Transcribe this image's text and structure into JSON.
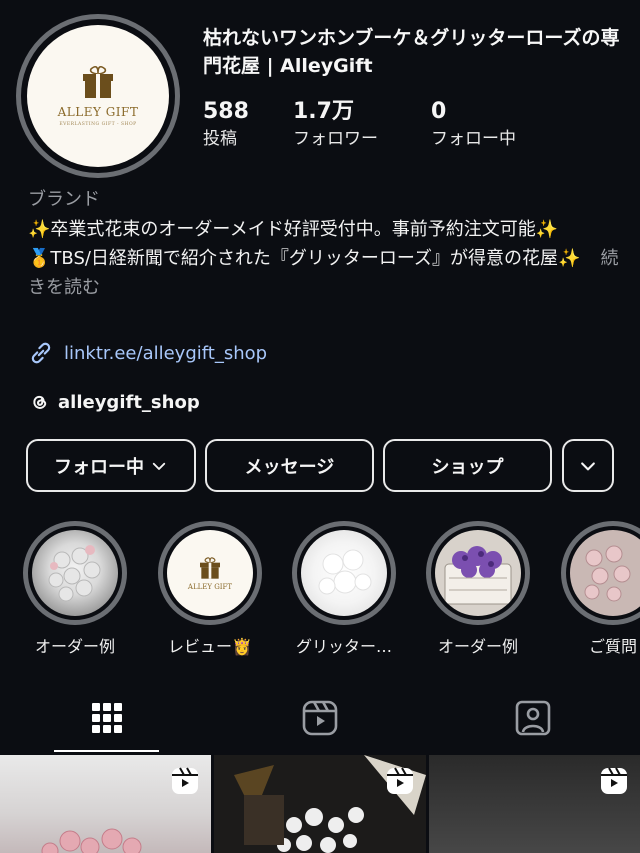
{
  "profile": {
    "name": "枯れないワンホンブーケ＆グリッターローズの専門花屋 | AlleyGift",
    "avatar_logo": "ALLEY GIFT",
    "avatar_tagline": "EVERLASTING GIFT - SHOP"
  },
  "stats": [
    {
      "value": "588",
      "label": "投稿"
    },
    {
      "value": "1.7万",
      "label": "フォロワー"
    },
    {
      "value": "0",
      "label": "フォロー中"
    }
  ],
  "category": "ブランド",
  "bio": {
    "line1": "✨卒業式花束のオーダーメイド好評受付中。事前予約注文可能✨",
    "line2": "🥇TBS/日経新聞で紹介された『グリッターローズ』が得意の花屋✨",
    "more": "続きを読む"
  },
  "link": "linktr.ee/alleygift_shop",
  "threads_handle": "alleygift_shop",
  "buttons": {
    "follow": "フォロー中",
    "message": "メッセージ",
    "shop": "ショップ"
  },
  "highlights": [
    {
      "label": "オーダー例"
    },
    {
      "label": "レビュー👸"
    },
    {
      "label": "グリッター…"
    },
    {
      "label": "オーダー例"
    },
    {
      "label": "ご質問"
    }
  ],
  "tabs": [
    "grid-icon",
    "reels-icon",
    "tagged-icon"
  ],
  "colors": {
    "background": "#0b0d12",
    "link": "#a8c7fa",
    "ring": "#6b6e73",
    "muted": "#9a9da3"
  }
}
